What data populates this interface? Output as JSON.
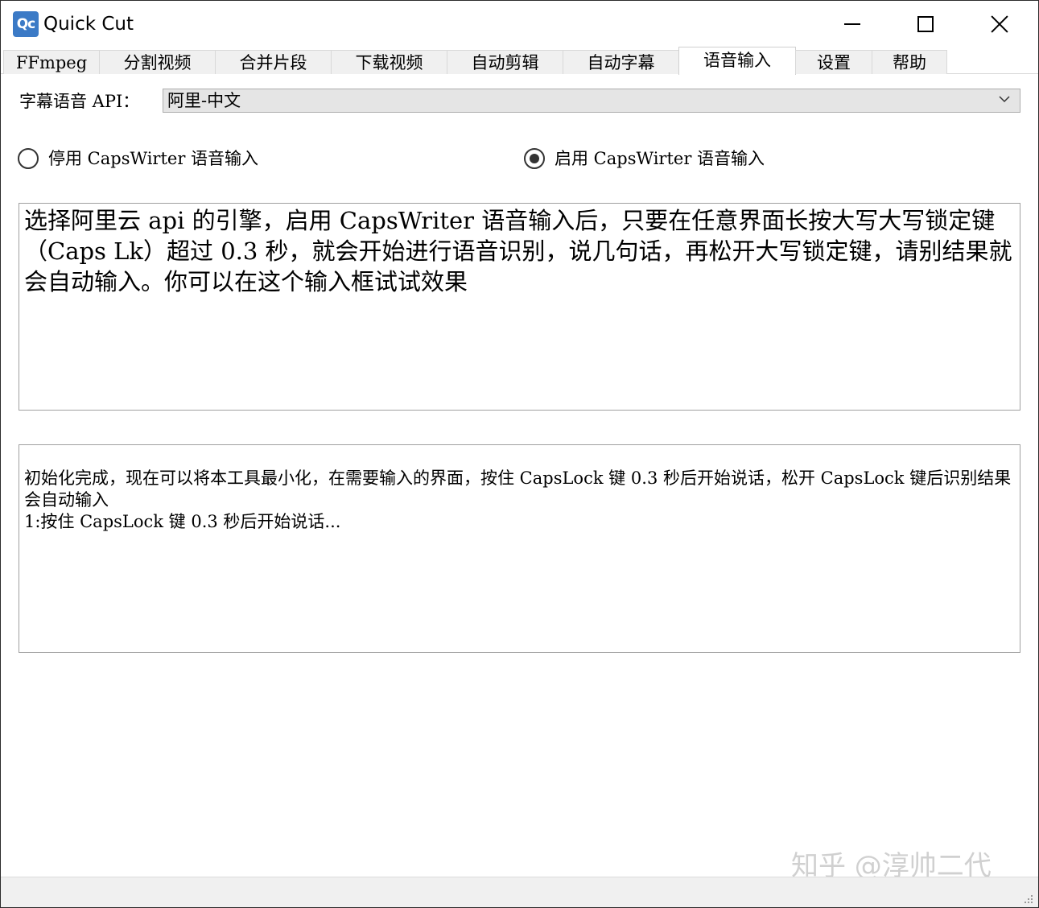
{
  "window": {
    "app_icon_text": "Qc",
    "title": "Quick Cut",
    "icon_color": "#3b7ac6"
  },
  "tabs": [
    {
      "label": "FFmpeg"
    },
    {
      "label": "分割视频"
    },
    {
      "label": "合并片段"
    },
    {
      "label": "下载视频"
    },
    {
      "label": "自动剪辑"
    },
    {
      "label": "自动字幕"
    },
    {
      "label": "语音输入",
      "active": true
    },
    {
      "label": "设置"
    },
    {
      "label": "帮助"
    }
  ],
  "api": {
    "label": "字幕语音 API：",
    "selected": "阿里-中文"
  },
  "radios": {
    "disable_label": "停用 CapsWirter 语音输入",
    "enable_label": "启用 CapsWirter 语音输入",
    "selected": "enable"
  },
  "input_box": {
    "text": "选择阿里云 api 的引擎，启用 CapsWriter 语音输入后，只要在任意界面长按大写大写锁定键（Caps Lk）超过 0.3 秒，就会开始进行语音识别，说几句话，再松开大写锁定键，请别结果就会自动输入。你可以在这个输入框试试效果"
  },
  "log_box": {
    "lines": [
      "初始化完成，现在可以将本工具最小化，在需要输入的界面，按住 CapsLock 键 0.3 秒后开始说话，松开 CapsLock 键后识别结果会自动输入",
      "1:按住 CapsLock 键 0.3 秒后开始说话..."
    ]
  },
  "watermark": "知乎 @淳帅二代"
}
